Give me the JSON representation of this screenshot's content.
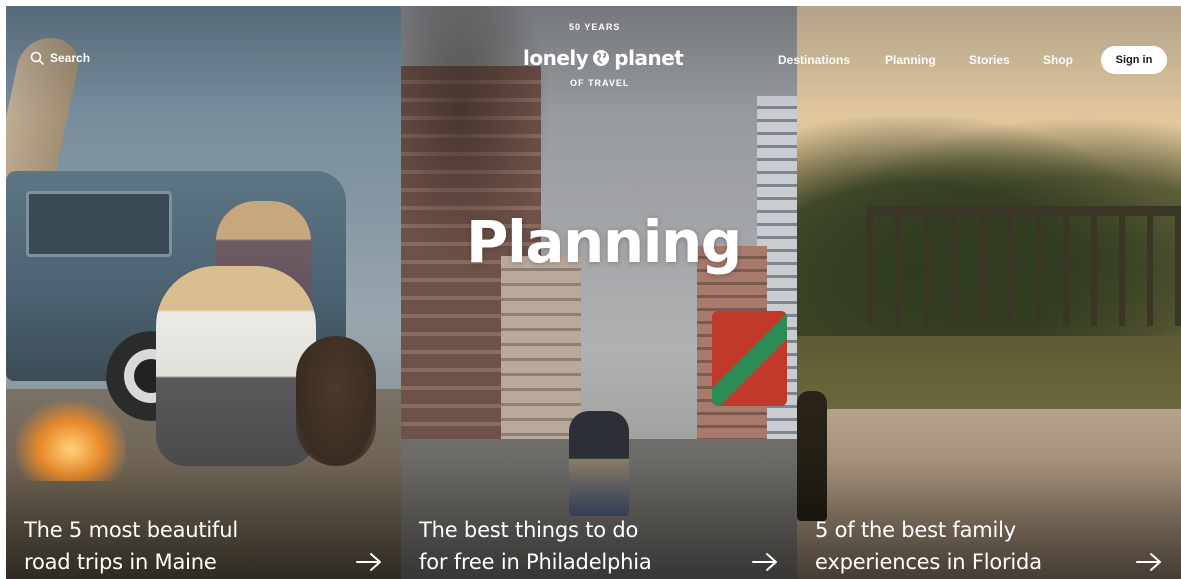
{
  "header": {
    "search_label": "Search",
    "logo": {
      "arc_top": "50 YEARS",
      "brand_left": "lonely",
      "brand_right": "planet",
      "arc_bottom": "OF TRAVEL"
    },
    "nav": [
      {
        "label": "Destinations"
      },
      {
        "label": "Planning"
      },
      {
        "label": "Stories"
      },
      {
        "label": "Shop"
      }
    ],
    "signin_label": "Sign in"
  },
  "hero": {
    "title": "Planning"
  },
  "cards": [
    {
      "line1": "The 5 most beautiful",
      "line2": "road trips in Maine"
    },
    {
      "line1": "The best things to do",
      "line2": "for free in Philadelphia"
    },
    {
      "line1": "5 of the best family",
      "line2": "experiences in Florida"
    }
  ],
  "icons": {
    "search": "search-icon",
    "globe": "globe-icon",
    "arrow": "arrow-right-icon"
  },
  "colors": {
    "text": "#ffffff",
    "signin_bg": "#ffffff",
    "signin_text": "#1a1a1a"
  }
}
